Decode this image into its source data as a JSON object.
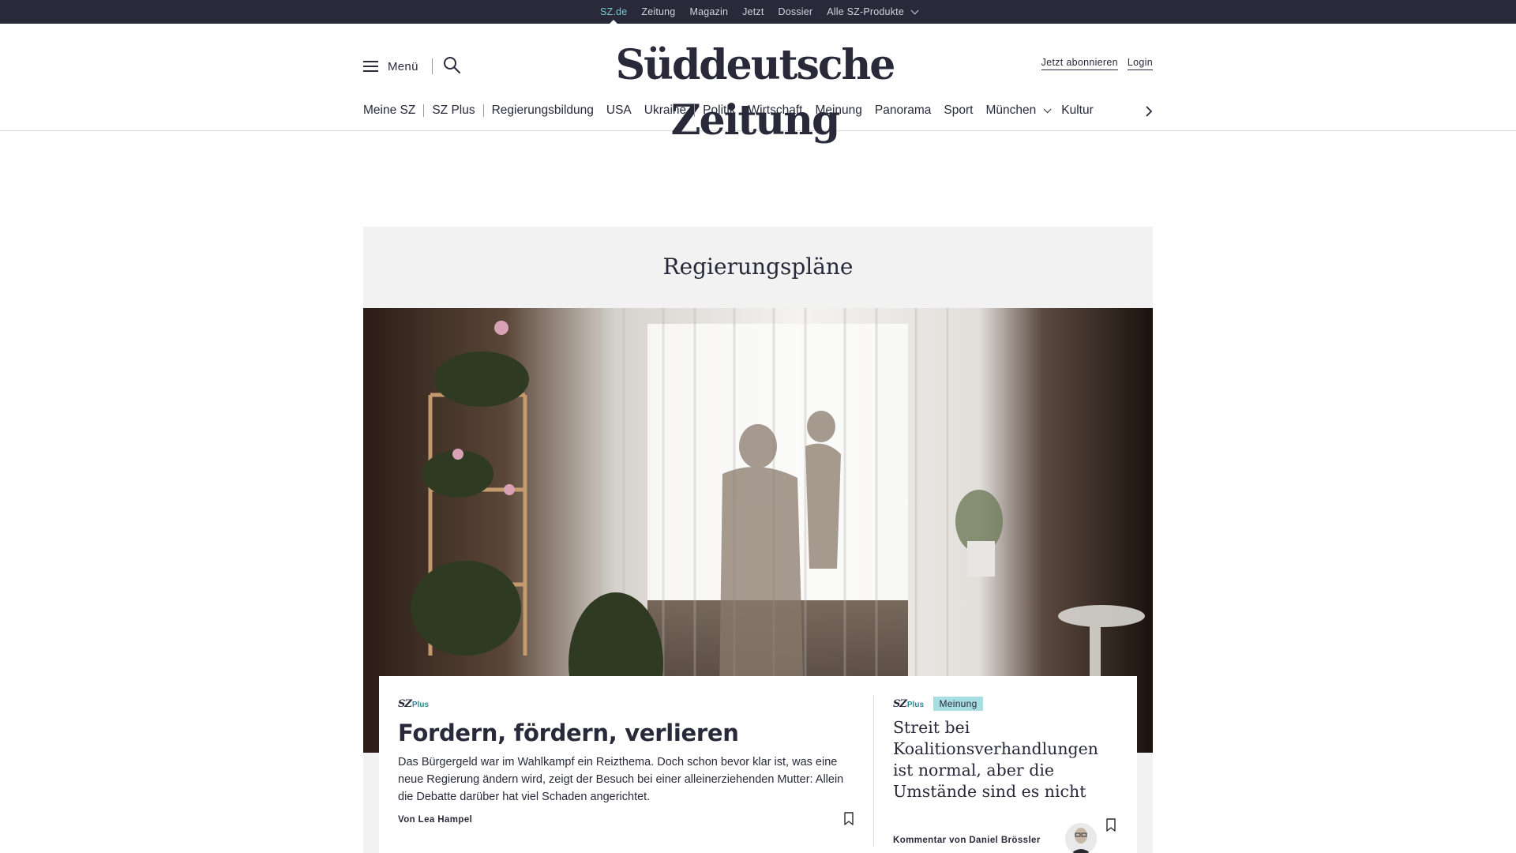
{
  "topbar": {
    "links": [
      {
        "label": "SZ.de",
        "active": true
      },
      {
        "label": "Zeitung",
        "active": false
      },
      {
        "label": "Magazin",
        "active": false
      },
      {
        "label": "Jetzt",
        "active": false
      },
      {
        "label": "Dossier",
        "active": false
      },
      {
        "label": "Alle SZ-Produkte",
        "active": false,
        "dropdown": true
      }
    ],
    "colors": {
      "background": "#29293a",
      "active": "#71c9d1"
    }
  },
  "header": {
    "menu_label": "Menü",
    "logo_text": "Süddeutsche Zeitung",
    "subscribe_label": "Jetzt abonnieren",
    "login_label": "Login"
  },
  "nav": {
    "items": [
      "Meine SZ",
      "SZ Plus",
      "Regierungsbildung",
      "USA",
      "Ukraine",
      "Politik",
      "Wirtschaft",
      "Meinung",
      "Panorama",
      "Sport",
      "München",
      "Kultur"
    ]
  },
  "topic": {
    "title": "Regierungspläne"
  },
  "lead_article": {
    "brand_sz": "SZ",
    "brand_plus": "Plus",
    "headline": "Fordern, fördern, verlieren",
    "teaser": "Das Bürgergeld war im Wahlkampf ein Reizthema. Doch schon bevor klar ist, was eine neue Regierung ändern wird, zeigt der Besuch bei einer alleinerziehenden Mutter: Allein die Debatte darüber hat viel Schaden angerichtet.",
    "author": "Von Lea Hampel"
  },
  "opinion_article": {
    "brand_sz": "SZ",
    "brand_plus": "Plus",
    "badge": "Meinung",
    "headline": "Streit bei Koalitionsverhandlungen ist normal, aber die Umstände sind es nicht",
    "author": "Kommentar von Daniel Brössler"
  },
  "icons": [
    "hamburger-icon",
    "search-icon",
    "chevron-down-icon",
    "chevron-right-icon",
    "bookmark-icon"
  ]
}
